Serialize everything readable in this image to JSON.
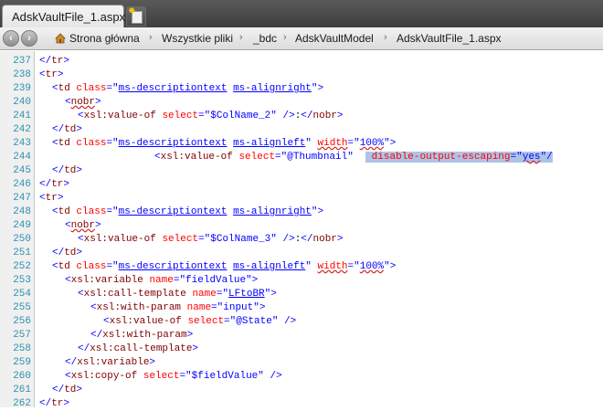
{
  "tab": {
    "active_label": "AdskVaultFile_1.aspx*"
  },
  "breadcrumb": [
    "Strona główna",
    "Wszystkie pliki",
    "_bdc",
    "AdskVaultModel",
    "AdskVaultFile_1.aspx"
  ],
  "code_lines": [
    {
      "n": "237",
      "indent": 0,
      "parts": [
        [
          "br",
          "</"
        ],
        [
          "tag",
          "tr"
        ],
        [
          "br",
          ">"
        ]
      ]
    },
    {
      "n": "238",
      "indent": 0,
      "parts": [
        [
          "br",
          "<"
        ],
        [
          "tag",
          "tr"
        ],
        [
          "br",
          ">"
        ]
      ]
    },
    {
      "n": "239",
      "indent": 1,
      "parts": [
        [
          "br",
          "<"
        ],
        [
          "tag",
          "td"
        ],
        [
          "txt",
          " "
        ],
        [
          "attr",
          "class"
        ],
        [
          "br",
          "=\""
        ],
        [
          "val ul",
          "ms-descriptiontext"
        ],
        [
          "val",
          " "
        ],
        [
          "val ul",
          "ms-alignright"
        ],
        [
          "br",
          "\">"
        ]
      ]
    },
    {
      "n": "240",
      "indent": 2,
      "parts": [
        [
          "br",
          "<"
        ],
        [
          "tag sq",
          "nobr"
        ],
        [
          "br",
          ">"
        ]
      ]
    },
    {
      "n": "241",
      "indent": 3,
      "parts": [
        [
          "br",
          "<"
        ],
        [
          "tag",
          "xsl:value-of"
        ],
        [
          "txt",
          " "
        ],
        [
          "attr",
          "select"
        ],
        [
          "br",
          "=\""
        ],
        [
          "val",
          "$ColName_2"
        ],
        [
          "br",
          "\""
        ],
        [
          "txt",
          " "
        ],
        [
          "br",
          "/>"
        ],
        [
          "txt",
          ":"
        ],
        [
          "br",
          "</"
        ],
        [
          "tag",
          "nobr"
        ],
        [
          "br",
          ">"
        ]
      ]
    },
    {
      "n": "242",
      "indent": 1,
      "parts": [
        [
          "br",
          "</"
        ],
        [
          "tag",
          "td"
        ],
        [
          "br",
          ">"
        ]
      ]
    },
    {
      "n": "243",
      "indent": 1,
      "parts": [
        [
          "br",
          "<"
        ],
        [
          "tag",
          "td"
        ],
        [
          "txt",
          " "
        ],
        [
          "attr",
          "class"
        ],
        [
          "br",
          "=\""
        ],
        [
          "val ul",
          "ms-descriptiontext"
        ],
        [
          "val",
          " "
        ],
        [
          "val ul",
          "ms-alignleft"
        ],
        [
          "br",
          "\""
        ],
        [
          "txt",
          " "
        ],
        [
          "attr sq",
          "width"
        ],
        [
          "br",
          "=\""
        ],
        [
          "val sq",
          "100%"
        ],
        [
          "br",
          "\">"
        ]
      ]
    },
    {
      "n": "244",
      "indent": 9,
      "parts": [
        [
          "br",
          "<"
        ],
        [
          "tag",
          "xsl:value-of"
        ],
        [
          "txt",
          " "
        ],
        [
          "attr",
          "select"
        ],
        [
          "br",
          "=\""
        ],
        [
          "val",
          "@Thumbnail"
        ],
        [
          "br",
          "\""
        ],
        [
          "txt",
          "  "
        ],
        [
          "attr sel",
          " disable-output-escaping"
        ],
        [
          "br sel",
          "=\""
        ],
        [
          "val sel sq",
          "yes"
        ],
        [
          "br sel",
          "\"/"
        ]
      ]
    },
    {
      "n": "245",
      "indent": 1,
      "parts": [
        [
          "br",
          "</"
        ],
        [
          "tag",
          "td"
        ],
        [
          "br",
          ">"
        ]
      ]
    },
    {
      "n": "246",
      "indent": 0,
      "parts": [
        [
          "br",
          "</"
        ],
        [
          "tag",
          "tr"
        ],
        [
          "br",
          ">"
        ]
      ]
    },
    {
      "n": "247",
      "indent": 0,
      "parts": [
        [
          "br",
          "<"
        ],
        [
          "tag",
          "tr"
        ],
        [
          "br",
          ">"
        ]
      ]
    },
    {
      "n": "248",
      "indent": 1,
      "parts": [
        [
          "br",
          "<"
        ],
        [
          "tag",
          "td"
        ],
        [
          "txt",
          " "
        ],
        [
          "attr",
          "class"
        ],
        [
          "br",
          "=\""
        ],
        [
          "val ul",
          "ms-descriptiontext"
        ],
        [
          "val",
          " "
        ],
        [
          "val ul",
          "ms-alignright"
        ],
        [
          "br",
          "\">"
        ]
      ]
    },
    {
      "n": "249",
      "indent": 2,
      "parts": [
        [
          "br",
          "<"
        ],
        [
          "tag sq",
          "nobr"
        ],
        [
          "br",
          ">"
        ]
      ]
    },
    {
      "n": "250",
      "indent": 3,
      "parts": [
        [
          "br",
          "<"
        ],
        [
          "tag",
          "xsl:value-of"
        ],
        [
          "txt",
          " "
        ],
        [
          "attr",
          "select"
        ],
        [
          "br",
          "=\""
        ],
        [
          "val",
          "$ColName_3"
        ],
        [
          "br",
          "\""
        ],
        [
          "txt",
          " "
        ],
        [
          "br",
          "/>"
        ],
        [
          "txt",
          ":"
        ],
        [
          "br",
          "</"
        ],
        [
          "tag",
          "nobr"
        ],
        [
          "br",
          ">"
        ]
      ]
    },
    {
      "n": "251",
      "indent": 1,
      "parts": [
        [
          "br",
          "</"
        ],
        [
          "tag",
          "td"
        ],
        [
          "br",
          ">"
        ]
      ]
    },
    {
      "n": "252",
      "indent": 1,
      "parts": [
        [
          "br",
          "<"
        ],
        [
          "tag",
          "td"
        ],
        [
          "txt",
          " "
        ],
        [
          "attr",
          "class"
        ],
        [
          "br",
          "=\""
        ],
        [
          "val ul",
          "ms-descriptiontext"
        ],
        [
          "val",
          " "
        ],
        [
          "val ul",
          "ms-alignleft"
        ],
        [
          "br",
          "\""
        ],
        [
          "txt",
          " "
        ],
        [
          "attr sq",
          "width"
        ],
        [
          "br",
          "=\""
        ],
        [
          "val sq",
          "100%"
        ],
        [
          "br",
          "\">"
        ]
      ]
    },
    {
      "n": "253",
      "indent": 2,
      "parts": [
        [
          "br",
          "<"
        ],
        [
          "tag",
          "xsl:variable"
        ],
        [
          "txt",
          " "
        ],
        [
          "attr",
          "name"
        ],
        [
          "br",
          "=\""
        ],
        [
          "val",
          "fieldValue"
        ],
        [
          "br",
          "\">"
        ]
      ]
    },
    {
      "n": "254",
      "indent": 3,
      "parts": [
        [
          "br",
          "<"
        ],
        [
          "tag",
          "xsl:call-template"
        ],
        [
          "txt",
          " "
        ],
        [
          "attr",
          "name"
        ],
        [
          "br",
          "=\""
        ],
        [
          "val ul",
          "LFtoBR"
        ],
        [
          "br",
          "\">"
        ]
      ]
    },
    {
      "n": "255",
      "indent": 4,
      "parts": [
        [
          "br",
          "<"
        ],
        [
          "tag",
          "xsl:with-param"
        ],
        [
          "txt",
          " "
        ],
        [
          "attr",
          "name"
        ],
        [
          "br",
          "=\""
        ],
        [
          "val",
          "input"
        ],
        [
          "br",
          "\">"
        ]
      ]
    },
    {
      "n": "256",
      "indent": 5,
      "parts": [
        [
          "br",
          "<"
        ],
        [
          "tag",
          "xsl:value-of"
        ],
        [
          "txt",
          " "
        ],
        [
          "attr",
          "select"
        ],
        [
          "br",
          "=\""
        ],
        [
          "val",
          "@State"
        ],
        [
          "br",
          "\""
        ],
        [
          "txt",
          " "
        ],
        [
          "br",
          "/>"
        ]
      ]
    },
    {
      "n": "257",
      "indent": 4,
      "parts": [
        [
          "br",
          "</"
        ],
        [
          "tag",
          "xsl:with-param"
        ],
        [
          "br",
          ">"
        ]
      ]
    },
    {
      "n": "258",
      "indent": 3,
      "parts": [
        [
          "br",
          "</"
        ],
        [
          "tag",
          "xsl:call-template"
        ],
        [
          "br",
          ">"
        ]
      ]
    },
    {
      "n": "259",
      "indent": 2,
      "parts": [
        [
          "br",
          "</"
        ],
        [
          "tag",
          "xsl:variable"
        ],
        [
          "br",
          ">"
        ]
      ]
    },
    {
      "n": "260",
      "indent": 2,
      "parts": [
        [
          "br",
          "<"
        ],
        [
          "tag",
          "xsl:copy-of"
        ],
        [
          "txt",
          " "
        ],
        [
          "attr",
          "select"
        ],
        [
          "br",
          "=\""
        ],
        [
          "val",
          "$fieldValue"
        ],
        [
          "br",
          "\""
        ],
        [
          "txt",
          " "
        ],
        [
          "br",
          "/>"
        ]
      ]
    },
    {
      "n": "261",
      "indent": 1,
      "parts": [
        [
          "br",
          "</"
        ],
        [
          "tag",
          "td"
        ],
        [
          "br",
          ">"
        ]
      ]
    },
    {
      "n": "262",
      "indent": 0,
      "parts": [
        [
          "br",
          "</"
        ],
        [
          "tag",
          "tr"
        ],
        [
          "br",
          ">"
        ]
      ]
    }
  ]
}
